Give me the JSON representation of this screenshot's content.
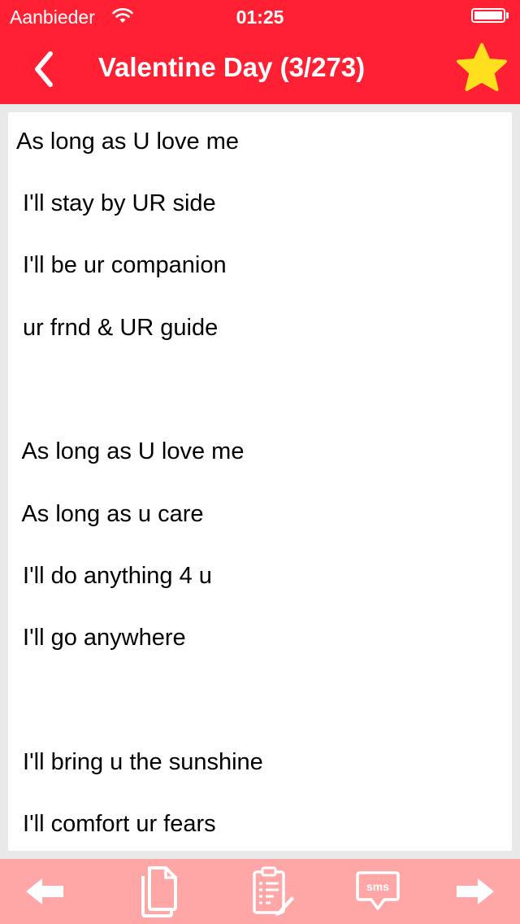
{
  "status_bar": {
    "carrier": "Aanbieder",
    "time": "01:25",
    "wifi_icon": "wifi-icon",
    "battery_icon": "battery-icon"
  },
  "nav": {
    "title": "Valentine Day (3/273)",
    "back_icon": "chevron-left-icon",
    "favorite_icon": "star-icon"
  },
  "message": {
    "lines": [
      "As long as U love me",
      " I'll stay by UR side",
      " I'll be ur companion",
      " ur frnd & UR guide",
      "",
      " As long as U love me",
      " As long as u care",
      " I'll do anything 4 u",
      " I'll go anywhere",
      "",
      " I'll bring u the sunshine",
      " I'll comfort ur fears"
    ]
  },
  "toolbar": {
    "items": [
      "arrow-left-icon",
      "copy-icon",
      "edit-note-icon",
      "sms-icon",
      "arrow-right-icon"
    ],
    "sms_label": "sms"
  },
  "colors": {
    "header": "#ff2133",
    "toolbar": "#ffa7a7",
    "star": "#ffdf1e",
    "background": "#e9e9e9"
  }
}
